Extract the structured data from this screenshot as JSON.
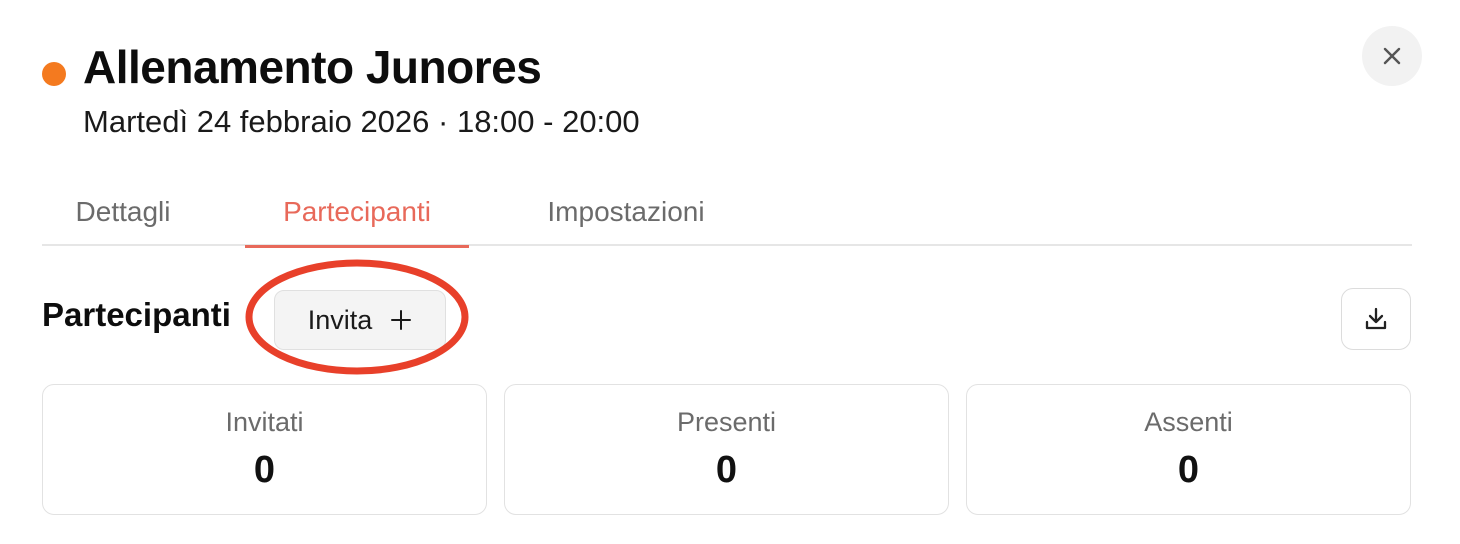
{
  "header": {
    "status_color": "#f47a1f",
    "title": "Allenamento Junores",
    "subtitle": "Martedì 24 febbraio 2026 · 18:00 - 20:00",
    "close_icon": "close-icon"
  },
  "tabs": [
    {
      "label": "Dettagli",
      "active": false
    },
    {
      "label": "Partecipanti",
      "active": true
    },
    {
      "label": "Impostazioni",
      "active": false
    }
  ],
  "section": {
    "title": "Partecipanti",
    "invite_label": "Invita",
    "invite_icon": "plus-icon",
    "download_icon": "download-icon",
    "highlight_color": "#e8402a"
  },
  "stats": [
    {
      "label": "Invitati",
      "value": "0"
    },
    {
      "label": "Presenti",
      "value": "0"
    },
    {
      "label": "Assenti",
      "value": "0"
    }
  ],
  "colors": {
    "accent": "#e8695a",
    "status_dot": "#f47a1f"
  }
}
